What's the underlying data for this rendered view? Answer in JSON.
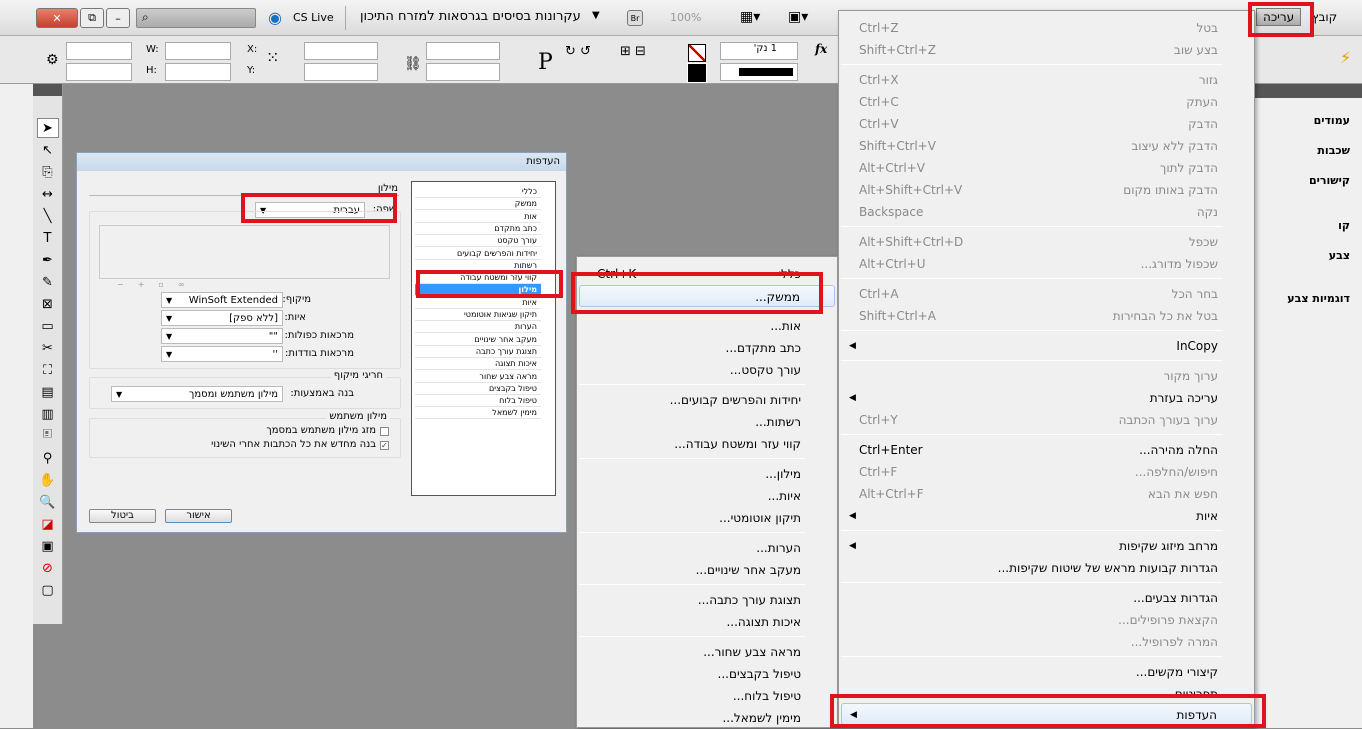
{
  "topbar": {
    "search_placeholder": "",
    "cs_live": "CS Live",
    "document_title": "עקרונות בסיסים בגרסאות למזרח התיכון",
    "bridge": "Br",
    "zoom": "100%",
    "menu_file": "קובץ",
    "menu_edit": "עריכה"
  },
  "controlbar": {
    "w_label": "W:",
    "h_label": "H:",
    "x_label": "X:",
    "y_label": "Y:",
    "stroke_weight": "1 נק'",
    "fx": "fx"
  },
  "right_panel": {
    "items": [
      "עמודים",
      "שכבות",
      "קישורים",
      "קו",
      "צבע",
      "דוגמיות צבע"
    ]
  },
  "edit_menu": {
    "items": [
      {
        "label": "בטל",
        "shortcut": "Ctrl+Z",
        "disabled": true
      },
      {
        "label": "בצע שוב",
        "shortcut": "Shift+Ctrl+Z",
        "disabled": true
      },
      {
        "sep": true
      },
      {
        "label": "גזור",
        "shortcut": "Ctrl+X",
        "disabled": true
      },
      {
        "label": "העתק",
        "shortcut": "Ctrl+C",
        "disabled": true
      },
      {
        "label": "הדבק",
        "shortcut": "Ctrl+V",
        "disabled": true
      },
      {
        "label": "הדבק ללא עיצוב",
        "shortcut": "Shift+Ctrl+V",
        "disabled": true
      },
      {
        "label": "הדבק לתוך",
        "shortcut": "Alt+Ctrl+V",
        "disabled": true
      },
      {
        "label": "הדבק באותו מקום",
        "shortcut": "Alt+Shift+Ctrl+V",
        "disabled": true
      },
      {
        "label": "נקה",
        "shortcut": "Backspace",
        "disabled": true
      },
      {
        "sep": true
      },
      {
        "label": "שכפל",
        "shortcut": "Alt+Shift+Ctrl+D",
        "disabled": true
      },
      {
        "label": "שכפול מדורג...",
        "shortcut": "Alt+Ctrl+U",
        "disabled": true
      },
      {
        "sep": true
      },
      {
        "label": "בחר הכל",
        "shortcut": "Ctrl+A",
        "disabled": true
      },
      {
        "label": "בטל את כל הבחירות",
        "shortcut": "Shift+Ctrl+A",
        "disabled": true
      },
      {
        "sep": true
      },
      {
        "label": "InCopy",
        "submenu": true
      },
      {
        "sep": true
      },
      {
        "label": "ערוך מקור",
        "disabled": true
      },
      {
        "label": "עריכה בעזרת",
        "submenu": true
      },
      {
        "label": "ערוך בעורך הכתבה",
        "shortcut": "Ctrl+Y",
        "disabled": true
      },
      {
        "sep": true
      },
      {
        "label": "החלה מהירה...",
        "shortcut": "Ctrl+Enter"
      },
      {
        "label": "חיפוש/החלפה...",
        "shortcut": "Ctrl+F",
        "disabled": true
      },
      {
        "label": "חפש את הבא",
        "shortcut": "Alt+Ctrl+F",
        "disabled": true
      },
      {
        "label": "איות",
        "submenu": true
      },
      {
        "sep": true
      },
      {
        "label": "מרחב מיזוג שקיפות",
        "submenu": true
      },
      {
        "label": "הגדרות קבועות מראש של שיטוח שקיפות..."
      },
      {
        "sep": true
      },
      {
        "label": "הגדרות צבעים..."
      },
      {
        "label": "הקצאת פרופילים...",
        "disabled": true
      },
      {
        "label": "המרה לפרופיל...",
        "disabled": true
      },
      {
        "sep": true
      },
      {
        "label": "קיצורי מקשים..."
      },
      {
        "label": "תפריטים"
      }
    ],
    "highlighted": {
      "label": "העדפות",
      "submenu": true
    }
  },
  "prefs_submenu": {
    "items": [
      {
        "label": "כללי",
        "shortcut": "Ctrl+K"
      },
      {
        "label": "ממשק...",
        "highlighted": true
      },
      {
        "sep": true
      },
      {
        "label": "אות..."
      },
      {
        "label": "כתב מתקדם..."
      },
      {
        "label": "עורך טקסט..."
      },
      {
        "sep": true
      },
      {
        "label": "יחידות והפרשים קבועים..."
      },
      {
        "label": "רשתות..."
      },
      {
        "label": "קווי עזר ומשטח עבודה..."
      },
      {
        "sep": true
      },
      {
        "label": "מילון..."
      },
      {
        "label": "איות..."
      },
      {
        "label": "תיקון אוטומטי..."
      },
      {
        "sep": true
      },
      {
        "label": "הערות..."
      },
      {
        "label": "מעקב אחר שינויים..."
      },
      {
        "sep": true
      },
      {
        "label": "תצוגת עורך כתבה..."
      },
      {
        "label": "איכות תצוגה..."
      },
      {
        "sep": true
      },
      {
        "label": "מראה צבע שחור..."
      },
      {
        "label": "טיפול בקבצים..."
      },
      {
        "label": "טיפול בלוח..."
      },
      {
        "label": "מימין לשמאל..."
      }
    ]
  },
  "dialog": {
    "title": "העדפות",
    "categories": [
      "כללי",
      "ממשק",
      "אות",
      "כתב מתקדם",
      "עורך טקסט",
      "יחידות והפרשים קבועים",
      "רשתות",
      "קווי עזר ומשטח עבודה",
      "מילון",
      "איות",
      "תיקון שגיאות אוטומטי",
      "הערות",
      "מעקב אחר שינויים",
      "תצוגת עורך כתבה",
      "איכות תצוגה",
      "מראה צבע שחור",
      "טיפול בקבצים",
      "טיפול בלוח",
      "מימין לשמאל"
    ],
    "selected_category": "מילון",
    "section_title": "מילון",
    "language_label": "שפה:",
    "language_value": "עברית",
    "hyphenation_label": "מיקוף:",
    "hyphenation_value": "WinSoft Extended",
    "spelling_label": "איות:",
    "spelling_value": "[ללא ספק]",
    "double_quotes_label": "מרכאות כפולות:",
    "double_quotes_value": "\"\"",
    "single_quotes_label": "מרכאות בודדות:",
    "single_quotes_value": "''",
    "exceptions_title": "חריגי מיקוף",
    "compose_using_label": "בנה באמצעות:",
    "compose_using_value": "מילון משתמש ומסמך",
    "user_dict_title": "מילון משתמש",
    "merge_label": "מזג מילון משתמש במסמך",
    "merge_checked": false,
    "recompose_label": "בנה מחדש את כל הכתבות אחרי השינוי",
    "recompose_checked": true,
    "ok": "אישור",
    "cancel": "ביטול"
  }
}
